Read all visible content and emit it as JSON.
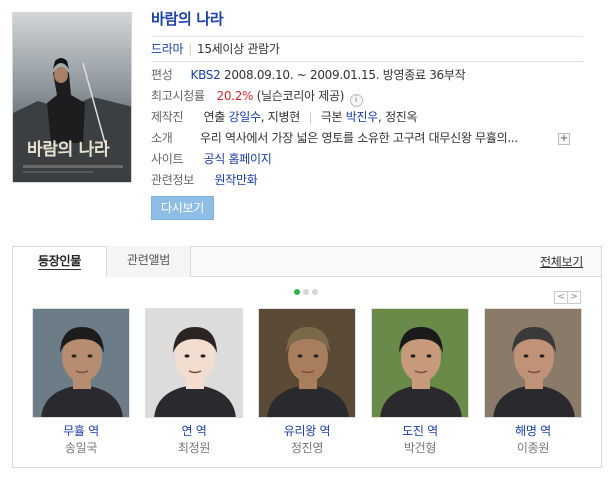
{
  "drama": {
    "title": "바람의 나라",
    "genre": "드라마",
    "rating": "15세이상 관람가",
    "broadcast": {
      "label": "편성",
      "channel": "KBS2",
      "period": "2008.09.10. ~ 2009.01.15.",
      "status": "방영종료",
      "episodes": "36부작"
    },
    "viewership": {
      "label": "최고시청률",
      "value": "20.2%",
      "source": "(닐슨코리아 제공)"
    },
    "crew": {
      "label": "제작진",
      "director_prefix": "연출",
      "director": "강일수",
      "director2": "지병현",
      "writer_prefix": "극본",
      "writer": "박진우",
      "writer2": "정진옥"
    },
    "summary": {
      "label": "소개",
      "text": "우리 역사에서 가장 넓은 영토를 소유한 고구려 대무신왕 무휼의..."
    },
    "site": {
      "label": "사이트",
      "link": "공식 홈페이지"
    },
    "related": {
      "label": "관련정보",
      "link": "원작만화"
    },
    "rewatch_button": "다시보기"
  },
  "panel": {
    "tabs": [
      {
        "label": "등장인물",
        "active": true
      },
      {
        "label": "관련앨범",
        "active": false
      }
    ],
    "view_all": "전체보기",
    "page_dots": 3,
    "current_page": 1,
    "cast": [
      {
        "role": "무휼 역",
        "actor": "송일국",
        "bg": "#6d7d88",
        "face": "#b68d70",
        "hair": "#1c1c1c"
      },
      {
        "role": "연 역",
        "actor": "최정원",
        "bg": "#dcdcdc",
        "face": "#f2ddd0",
        "hair": "#2b2422"
      },
      {
        "role": "유리왕 역",
        "actor": "정진영",
        "bg": "#5a4a35",
        "face": "#a97e5c",
        "hair": "#7a6a4a"
      },
      {
        "role": "도진 역",
        "actor": "박건형",
        "bg": "#6a8a4a",
        "face": "#c79a7c",
        "hair": "#1a1a1a"
      },
      {
        "role": "해명 역",
        "actor": "이종원",
        "bg": "#8a7a6a",
        "face": "#c09277",
        "hair": "#3a3a3a"
      }
    ]
  },
  "colors": {
    "link": "#1b40a8",
    "rating_red": "#d12a2a",
    "button": "#8fbde6",
    "dot_active": "#2eb34a"
  }
}
